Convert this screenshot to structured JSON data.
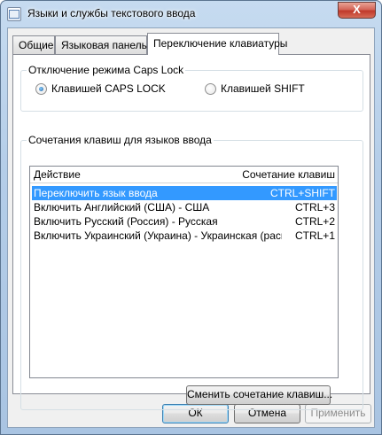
{
  "window": {
    "title": "Языки и службы текстового ввода",
    "close_glyph": "X"
  },
  "tabs": [
    {
      "label": "Общие"
    },
    {
      "label": "Языковая панель"
    },
    {
      "label": "Переключение клавиатуры",
      "active": true
    }
  ],
  "caps_lock_group": {
    "title": "Отключение режима Caps Lock",
    "options": [
      {
        "label": "Клавишей CAPS LOCK",
        "checked": true
      },
      {
        "label": "Клавишей SHIFT",
        "checked": false
      }
    ]
  },
  "hotkeys_group": {
    "title": "Сочетания клавиш для языков ввода",
    "columns": {
      "action": "Действие",
      "keys": "Сочетание клавиш"
    },
    "rows": [
      {
        "action": "Переключить язык ввода",
        "keys": "CTRL+SHIFT",
        "selected": true
      },
      {
        "action": "Включить Английский (США) - США",
        "keys": "CTRL+3"
      },
      {
        "action": "Включить Русский (Россия) - Русская",
        "keys": "CTRL+2"
      },
      {
        "action": "Включить Украинский (Украина) - Украинская (расш...",
        "keys": "CTRL+1"
      }
    ],
    "change_button": "Сменить сочетание клавиш..."
  },
  "footer": {
    "ok": "ОК",
    "cancel": "Отмена",
    "apply": "Применить"
  },
  "colors": {
    "selection": "#3399ff",
    "title_bar": "#b4cde8",
    "close_button": "#c0392b"
  }
}
